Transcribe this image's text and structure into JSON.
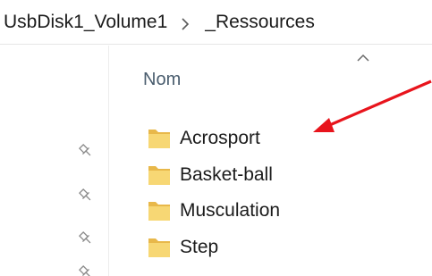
{
  "breadcrumb": {
    "items": [
      {
        "label": "UsbDisk1_Volume1"
      },
      {
        "label": "_Ressources"
      }
    ],
    "separator_icon": "chevron-right-icon"
  },
  "file_list": {
    "column_header": "Nom",
    "sort_icon": "chevron-up-icon",
    "folder_icon": "folder-icon",
    "items": [
      {
        "label": "Acrosport"
      },
      {
        "label": "Basket-ball"
      },
      {
        "label": "Musculation"
      },
      {
        "label": "Step"
      }
    ]
  },
  "navigation_pane": {
    "pin_icon": "pin-icon"
  },
  "annotation": {
    "arrow_color": "#e8141c",
    "points_to": "Acrosport"
  },
  "colors": {
    "folder": "#f7d774",
    "folder_back": "#e8b84a",
    "header_text": "#4a5d6e"
  }
}
